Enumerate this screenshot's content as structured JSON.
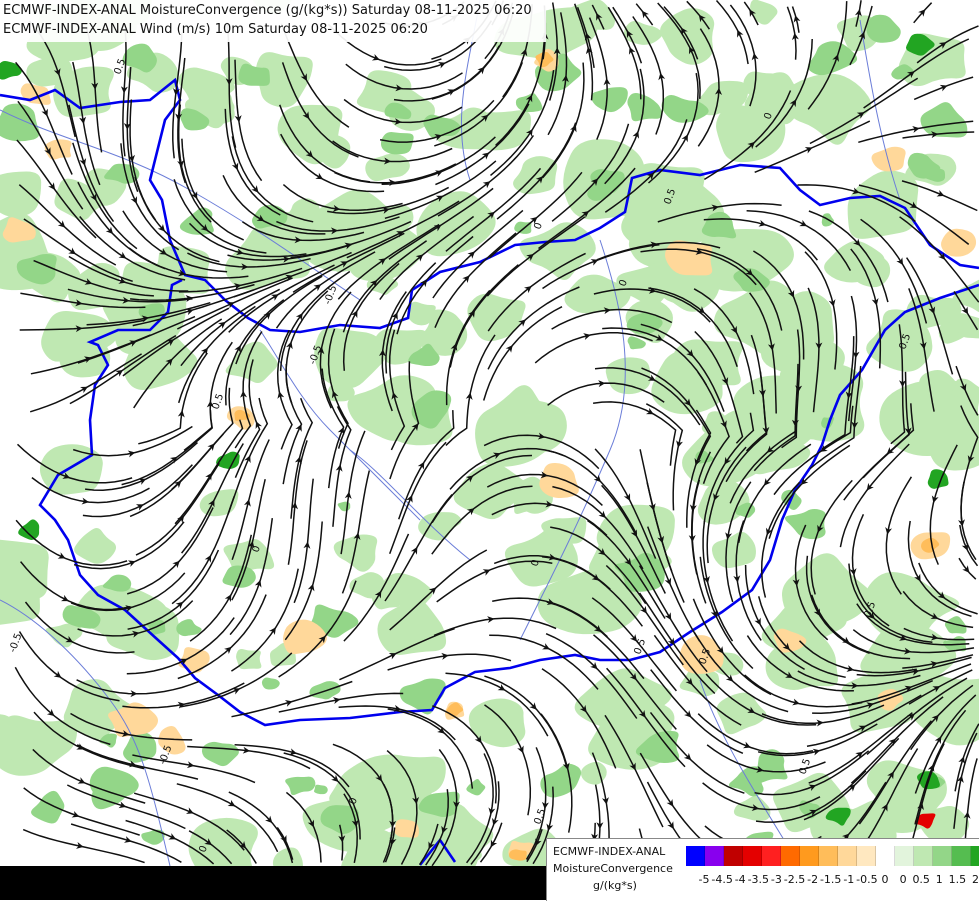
{
  "header": {
    "line1": "ECMWF-INDEX-ANAL MoistureConvergence (g/(kg*s)) Saturday 08-11-2025 06:20",
    "line2": "ECMWF-INDEX-ANAL Wind (m/s) 10m Saturday 08-11-2025 06:20"
  },
  "legend": {
    "model": "ECMWF-INDEX-ANAL",
    "variable": "MoistureConvergence",
    "unit": "g/(kg*s)",
    "colors": [
      "#0000ff",
      "#8800ee",
      "#c00000",
      "#e40000",
      "#ff2020",
      "#ff6a00",
      "#ff9a1e",
      "#ffbd5a",
      "#ffd89a",
      "#ffe8c0",
      "#ffffff",
      "#e2f4dc",
      "#bfe8b2",
      "#93d688",
      "#55bd50",
      "#22a522"
    ],
    "tick_labels": [
      "-5",
      "-4.5",
      "-4",
      "-3.5",
      "-3",
      "-2.5",
      "-2",
      "-1.5",
      "-1",
      "-0.5",
      "0",
      "0",
      "0.5",
      "1",
      "1.5",
      "2"
    ]
  },
  "map": {
    "contour_labels": [
      "0.5",
      "0",
      "-0.5",
      "0.5",
      "0",
      "0",
      "-0.5",
      "0.5",
      "0",
      "0",
      "0.5",
      "0.5",
      "-0.5",
      "0.5",
      "0",
      "0.5",
      "0.5",
      "0",
      "0.5",
      "-0.5"
    ],
    "colors": {
      "background": "#ffffff",
      "convergence_light": "#bfe8b2",
      "convergence_mid": "#93d688",
      "convergence_strong": "#22a522",
      "divergence_light": "#ffd89a",
      "divergence_mid": "#ffbd5a",
      "divergence_strong": "#e40000",
      "country_border": "#0000ee",
      "rivers": "#6b7dd8",
      "streamlines": "#111111"
    }
  }
}
